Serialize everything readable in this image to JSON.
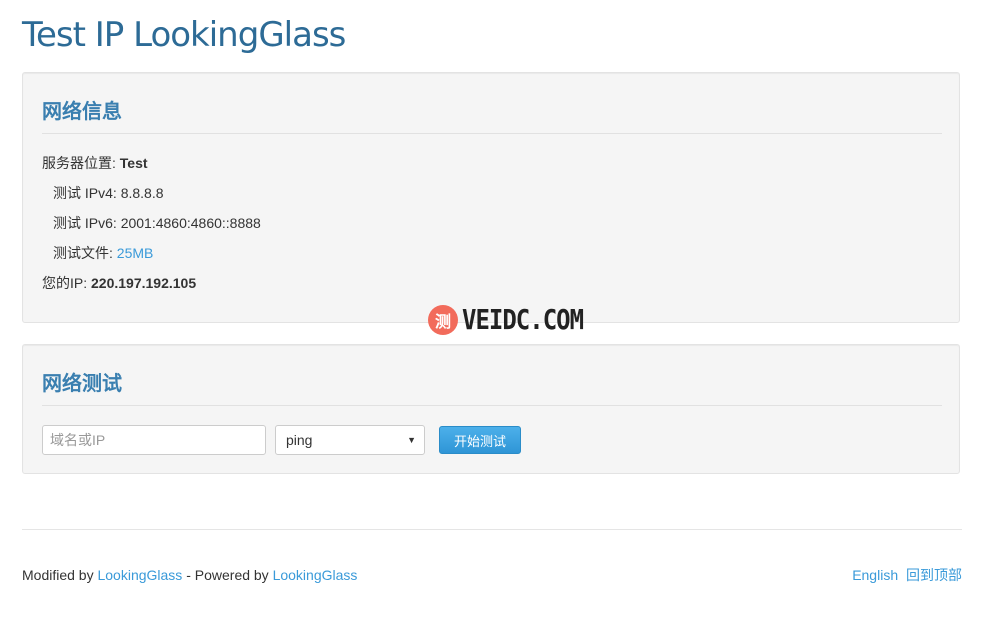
{
  "page": {
    "title": "Test IP LookingGlass"
  },
  "network_info": {
    "heading": "网络信息",
    "server_location_label": "服务器位置:",
    "server_location_value": "Test",
    "ipv4_label": "测试 IPv4:",
    "ipv4_value": "8.8.8.8",
    "ipv6_label": "测试 IPv6:",
    "ipv6_value": "2001:4860:4860::8888",
    "file_label": "测试文件:",
    "file_link": "25MB",
    "your_ip_label": "您的IP:",
    "your_ip_value": "220.197.192.105"
  },
  "watermark": {
    "badge_char": "测",
    "text": "VEIDC.COM"
  },
  "network_test": {
    "heading": "网络测试",
    "host_placeholder": "域名或IP",
    "host_value": "",
    "method_selected": "ping",
    "start_button": "开始测试"
  },
  "footer": {
    "modified_by": "Modified by",
    "modified_link": "LookingGlass",
    "separator": "- Powered by",
    "powered_link": "LookingGlass",
    "english_link": "English",
    "top_link": "回到顶部"
  },
  "colors": {
    "title": "#2d6b96",
    "heading": "#3a7fb0",
    "link": "#3a9ad9",
    "button": "#3a9de0",
    "well_bg": "#f5f5f5"
  }
}
